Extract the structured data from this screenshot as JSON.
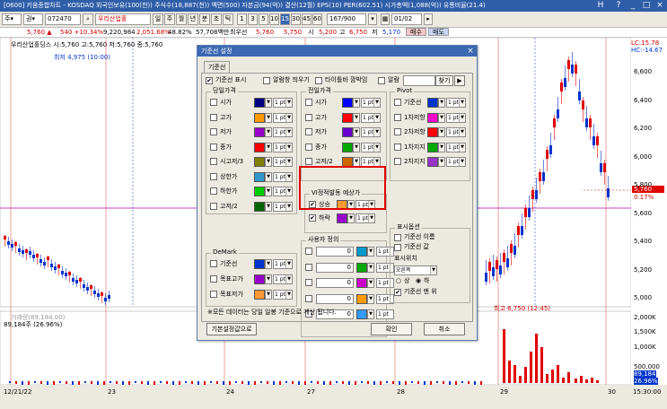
{
  "title_bar": {
    "text": "[0600] 키움종합차트 - KOSDAQ 외국인보유(100(천)) 주식수(18,887(천)) 액면(500) 자본금(94(억)) 결산(12월) EPS(10) PER(602.51) 시가총액(1,088(억)) 유통비율(21.4)",
    "controls": [
      "H",
      "?",
      "_",
      "□",
      "×"
    ]
  },
  "toolbar": {
    "mode": "주",
    "type": "권",
    "code": "072470",
    "search_icon": "search-icon",
    "name": "우리산업홀",
    "period_buttons": [
      "일",
      "주",
      "월",
      "년",
      "분",
      "초",
      "틱"
    ],
    "interval_buttons": [
      "1",
      "3",
      "5",
      "10",
      "15",
      "30",
      "45",
      "60"
    ],
    "active_interval": "15",
    "count": "167/900",
    "date": "01/02"
  },
  "price_row": {
    "price": "5,760 ▲",
    "change": "540 +10.34%",
    "volume": "9,220,984",
    "amount": "2,051.68%",
    "ratio": "48.82%",
    "trade_value": "57,708백만",
    "min_label": "최우선",
    "ask": "5,760",
    "bid": "5,750",
    "open_label": "시",
    "open": "5,200",
    "high_label": "고",
    "high": "6,750",
    "low_label": "저",
    "low": "5,170",
    "buy_label": "매수",
    "sell_label": "매도"
  },
  "chart": {
    "legend": "우리산업홀딩스 시:5,760 고:5,760 저:5,760 종:5,760",
    "low_annotation": "최저 4,975 (10:00)",
    "high_annotation": "최고 6,750 (12:45)",
    "lc_label": "LC:15.78",
    "hc_label": "HC:-14.67",
    "price_ticks": [
      "6,600",
      "6,400",
      "6,200",
      "6,000",
      "5,800",
      "5,600",
      "5,400",
      "5,200",
      "5,000"
    ],
    "current_price": "5,760",
    "current_change": "0.17%",
    "volume_legend": "거래량(89,184.00)",
    "volume_value": "89,184주 (26.96%)",
    "volume_ticks": [
      "2,000K",
      "1,500K",
      "1,000K",
      "500,000",
      "89,184",
      "26.96%"
    ],
    "date_labels": [
      "12/21/22",
      "23",
      "24",
      "27",
      "28",
      "29",
      "30"
    ],
    "time_label": "15:30:00"
  },
  "dialog": {
    "title": "기준선 설정",
    "close": "×",
    "tab": "기준선",
    "top_options": [
      {
        "label": "기준선 표시",
        "checked": true
      },
      {
        "label": "알람창 띄우기",
        "checked": false
      },
      {
        "label": "타이틀바 깜박임",
        "checked": false
      },
      {
        "label": "알람",
        "checked": false
      }
    ],
    "find_button": "찾기",
    "play_icon": "play-icon",
    "today_group": {
      "title": "당일가격",
      "items": [
        {
          "label": "시가",
          "checked": false,
          "color": "#000080",
          "width": "1 pt"
        },
        {
          "label": "고가",
          "checked": false,
          "color": "#ff9900",
          "width": "1 pt"
        },
        {
          "label": "저가",
          "checked": false,
          "color": "#9900cc",
          "width": "1 pt"
        },
        {
          "label": "종가",
          "checked": false,
          "color": "#ff0000",
          "width": "1 pt"
        },
        {
          "label": "시고저/3",
          "checked": false,
          "color": "#808000",
          "width": "1 pt"
        },
        {
          "label": "상한가",
          "checked": false,
          "color": "#3399cc",
          "width": "1 pt"
        },
        {
          "label": "하한가",
          "checked": false,
          "color": "#00cc00",
          "width": "1 pt"
        },
        {
          "label": "고저/2",
          "checked": false,
          "color": "#006600",
          "width": "1 pt"
        }
      ]
    },
    "prev_group": {
      "title": "전일가격",
      "items": [
        {
          "label": "시가",
          "checked": false,
          "color": "#0000ff",
          "width": "1 pt"
        },
        {
          "label": "고가",
          "checked": false,
          "color": "#ff0000",
          "width": "1 pt"
        },
        {
          "label": "저가",
          "checked": false,
          "color": "#6600cc",
          "width": "1 pt"
        },
        {
          "label": "종가",
          "checked": false,
          "color": "#00aa00",
          "width": "1 pt"
        },
        {
          "label": "고저/2",
          "checked": false,
          "color": "#cc6600",
          "width": "1 pt"
        }
      ]
    },
    "pivot_group": {
      "title": "Pivot",
      "items": [
        {
          "label": "기준선",
          "checked": false,
          "color": "#0033cc",
          "width": "1 pt"
        },
        {
          "label": "1차저항",
          "checked": false,
          "color": "#ff00cc",
          "width": "1 pt"
        },
        {
          "label": "2차저항",
          "checked": false,
          "color": "#ff0000",
          "width": "1 pt"
        },
        {
          "label": "1차지지",
          "checked": false,
          "color": "#00aa00",
          "width": "1 pt"
        },
        {
          "label": "2차지지",
          "checked": false,
          "color": "#9933cc",
          "width": "1 pt"
        }
      ]
    },
    "vi_group": {
      "title": "VI정적발동 예상가",
      "items": [
        {
          "label": "상승",
          "checked": true,
          "color": "#ff9933",
          "width": "1 pt"
        },
        {
          "label": "하락",
          "checked": true,
          "color": "#9900cc",
          "width": "1 pt"
        }
      ]
    },
    "user_group": {
      "title": "사용자 정의",
      "items": [
        {
          "value": "0",
          "color": "#0099cc",
          "width": "1 pt"
        },
        {
          "value": "0",
          "color": "#00aa00",
          "width": "1 pt"
        },
        {
          "value": "0",
          "color": "#cc00cc",
          "width": "1 pt"
        },
        {
          "value": "0",
          "color": "#ff9900",
          "width": "1 pt"
        },
        {
          "value": "0",
          "color": "#3399ff",
          "width": "1 pt"
        }
      ]
    },
    "demark_group": {
      "title": "DeMark",
      "items": [
        {
          "label": "기준선",
          "checked": false,
          "color": "#0033cc",
          "width": "1 pt"
        },
        {
          "label": "목표고가",
          "checked": false,
          "color": "#9900cc",
          "width": "1 pt"
        },
        {
          "label": "목표저가",
          "checked": false,
          "color": "#ff9933",
          "width": "1 pt"
        }
      ]
    },
    "display_group": {
      "title": "표시옵션",
      "opt1": "기준선 이름",
      "opt2": "기준선 값",
      "pos_label": "표시위치",
      "pos_value": "오른쪽",
      "radio_up": "상",
      "radio_down": "하",
      "front": "기준선 맨 위"
    },
    "note": "※모든 데이터는 당일 일봉 기준으로 계산 됩니다.",
    "default_button": "기본설정값으로",
    "ok_button": "확인",
    "cancel_button": "취소"
  }
}
